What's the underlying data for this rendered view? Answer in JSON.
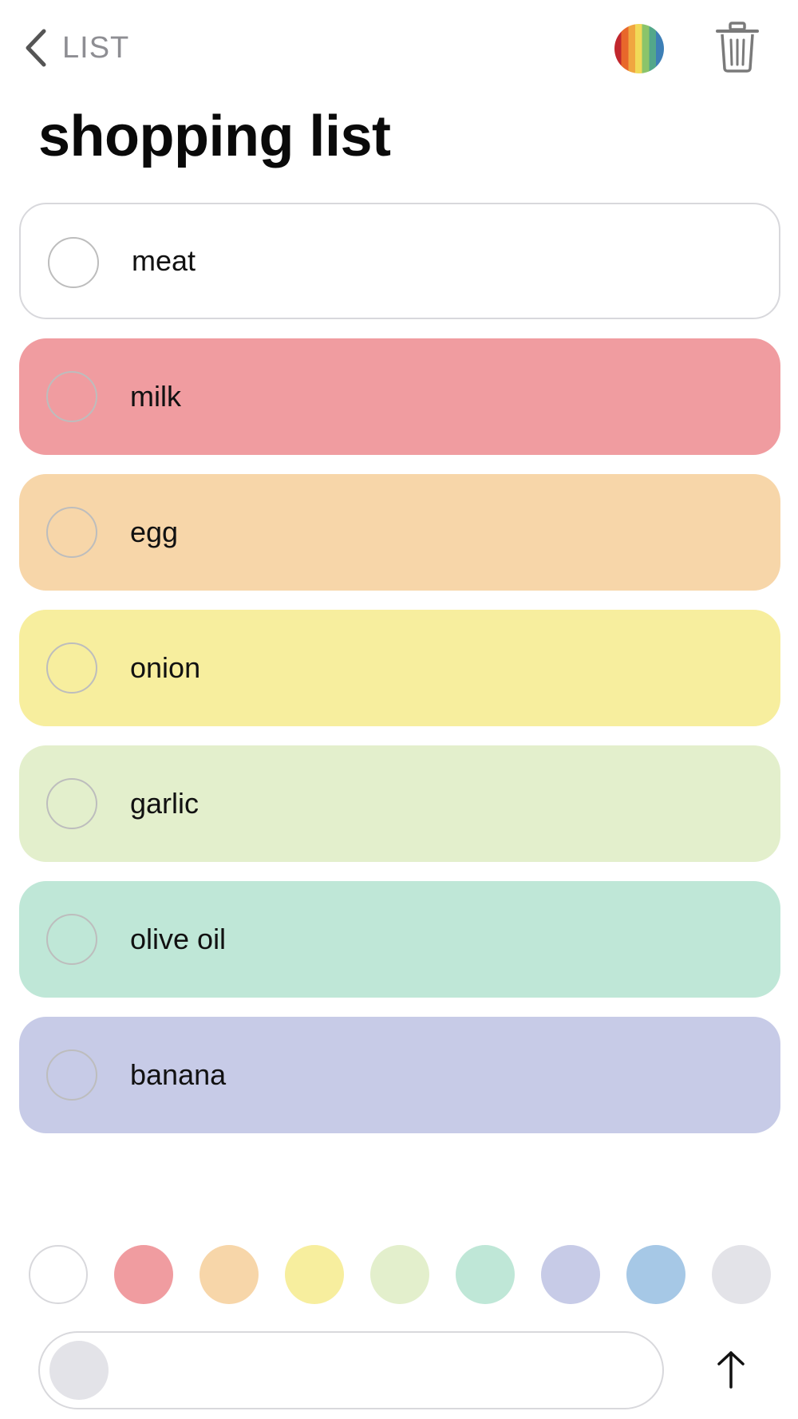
{
  "nav": {
    "back_label": "LIST",
    "back_icon": "chevron-left-icon",
    "color_picker_icon": "rainbow-circle-icon",
    "delete_icon": "trash-icon"
  },
  "list": {
    "title": "shopping list",
    "items": [
      {
        "label": "meat",
        "color": "#ffffff",
        "checked": false
      },
      {
        "label": "milk",
        "color": "#f09ca0",
        "checked": false
      },
      {
        "label": "egg",
        "color": "#f7d6a9",
        "checked": false
      },
      {
        "label": "onion",
        "color": "#f7ee9e",
        "checked": false
      },
      {
        "label": "garlic",
        "color": "#e3efcc",
        "checked": false
      },
      {
        "label": "olive oil",
        "color": "#bfe7d7",
        "checked": false
      },
      {
        "label": "banana",
        "color": "#c7cbe7",
        "checked": false
      }
    ]
  },
  "palette": {
    "colors": [
      "#ffffff",
      "#f09ca0",
      "#f7d6a9",
      "#f7ee9e",
      "#e3efcc",
      "#bfe7d7",
      "#c7cbe7",
      "#a6c8e6",
      "#e3e3e8"
    ]
  },
  "composer": {
    "input_value": "",
    "input_placeholder": "",
    "selected_color": "#e3e3e8",
    "send_icon": "arrow-up-icon"
  }
}
